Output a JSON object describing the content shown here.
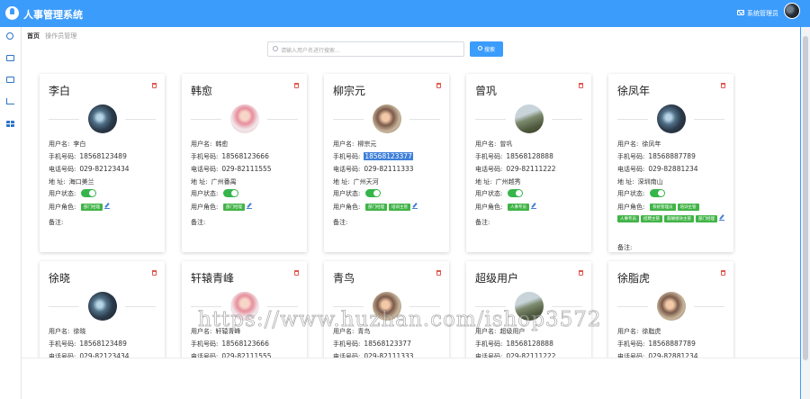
{
  "header": {
    "title": "人事管理系统",
    "admin_label": "系统管理员"
  },
  "breadcrumb": {
    "home": "首页",
    "current": "操作员管理"
  },
  "search": {
    "placeholder": "请输入用户名进行搜索...",
    "button_label": "搜索"
  },
  "labels": {
    "username": "用户名:",
    "phone": "手机号码:",
    "tel": "电话号码:",
    "address": "地 址:",
    "status": "用户状态:",
    "roles": "用户角色:",
    "remark": "备注:"
  },
  "users": [
    {
      "name": "李白",
      "username": "李白",
      "phone": "18568123489",
      "tel": "029-82123434",
      "address": "海口美兰",
      "roles": [
        "部门经理"
      ],
      "enabled": true
    },
    {
      "name": "韩愈",
      "username": "韩愈",
      "phone": "18568123666",
      "tel": "029-82111555",
      "address": "广州番禺",
      "roles": [
        "部门经理"
      ],
      "enabled": true
    },
    {
      "name": "柳宗元",
      "username": "柳宗元",
      "phone": "18568123377",
      "tel": "029-82111333",
      "address": "广州天河",
      "roles": [
        "部门经理",
        "培训主管"
      ],
      "enabled": true
    },
    {
      "name": "曾巩",
      "username": "曾巩",
      "phone": "18568128888",
      "tel": "029-82111222",
      "address": "广州越秀",
      "roles": [
        "人事专员"
      ],
      "enabled": true
    },
    {
      "name": "徐凤年",
      "username": "徐凤年",
      "phone": "18568887789",
      "tel": "029-82881234",
      "address": "深圳南山",
      "roles": [
        "系统管理员",
        "培训主管",
        "人事专员",
        "招聘主管",
        "薪酬绩效主管",
        "部门经理"
      ],
      "enabled": true
    },
    {
      "name": "徐晓",
      "username": "徐晓",
      "phone": "18568123489",
      "tel": "029-82123434"
    },
    {
      "name": "轩辕青峰",
      "username": "轩辕青峰",
      "phone": "18568123666",
      "tel": "029-82111555"
    },
    {
      "name": "青鸟",
      "username": "青鸟",
      "phone": "18568123377",
      "tel": "029-82111333"
    },
    {
      "name": "超级用户",
      "username": "超级用户",
      "phone": "18568128888",
      "tel": "029-82111222"
    },
    {
      "name": "徐脂虎",
      "username": "徐脂虎",
      "phone": "18568887789",
      "tel": "029-82881234"
    }
  ],
  "watermark": "https://www.huzhan.com/ishop3572",
  "colors": {
    "header": "#3c9cfc",
    "tag": "#41b447",
    "toggle": "#35b54a",
    "delete": "#e0584f"
  }
}
